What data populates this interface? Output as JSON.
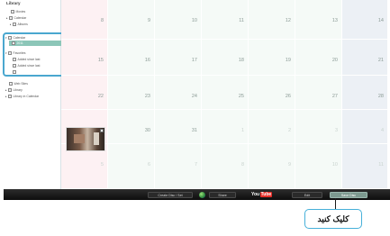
{
  "sidebar": {
    "title": "Library",
    "items": [
      {
        "label": "Movies",
        "arrow": "",
        "indent": 1
      },
      {
        "label": "Calendar",
        "arrow": "▸",
        "indent": 0
      },
      {
        "label": "Albums",
        "arrow": "▸",
        "indent": 1
      },
      {
        "label": "Calendar",
        "arrow": "▾",
        "indent": 0
      },
      {
        "label": "2011",
        "arrow": "",
        "indent": 1
      },
      {
        "label": "Favorites",
        "arrow": "▾",
        "indent": 0
      },
      {
        "label": "Added since last",
        "arrow": "",
        "indent": 1
      },
      {
        "label": "Added since last",
        "arrow": "",
        "indent": 1
      },
      {
        "label": "",
        "arrow": "",
        "indent": 1
      },
      {
        "label": "Web Sites",
        "arrow": "",
        "indent": 0
      },
      {
        "label": "Library",
        "arrow": "▸",
        "indent": 0
      },
      {
        "label": "Library in Calendar",
        "arrow": "▸",
        "indent": 0
      }
    ]
  },
  "calendar": {
    "rows": [
      [
        "8",
        "9",
        "10",
        "11",
        "12",
        "13",
        "14"
      ],
      [
        "15",
        "16",
        "17",
        "18",
        "19",
        "20",
        "21"
      ],
      [
        "22",
        "23",
        "24",
        "25",
        "26",
        "27",
        "28"
      ],
      [
        "29",
        "30",
        "31",
        "1",
        "2",
        "3",
        "4"
      ],
      [
        "5",
        "6",
        "7",
        "8",
        "9",
        "10",
        "11"
      ]
    ]
  },
  "toolbar": {
    "btn_create_disc": "Create Disc / Set",
    "btn_share": "Share",
    "youtube_you": "You",
    "youtube_tube": "Tube",
    "btn_edit": "Edit",
    "btn_save_disc": "Save Disc"
  },
  "callout": {
    "text": "کلیک کنید"
  }
}
